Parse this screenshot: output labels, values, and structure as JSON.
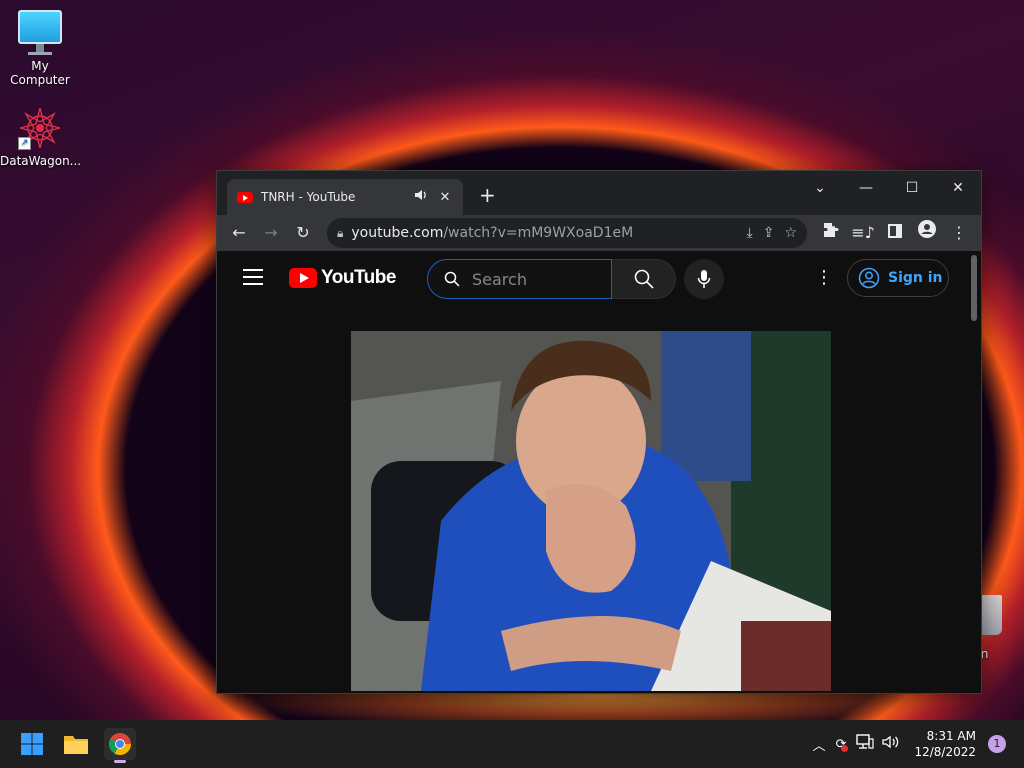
{
  "desktop": {
    "icons": [
      {
        "label": "My Computer"
      },
      {
        "label": "DataWagon..."
      },
      {
        "label": "e Bin"
      }
    ]
  },
  "browser": {
    "tab": {
      "title": "TNRH - YouTube",
      "audio_icon": "speaker-icon",
      "close": "✕"
    },
    "new_tab": "+",
    "window_controls": {
      "dropdown": "⌄",
      "minimize": "—",
      "maximize": "☐",
      "close": "✕"
    },
    "omnibox": {
      "host": "youtube.com",
      "path": "/watch?v=mM9WXoaD1eM"
    }
  },
  "youtube": {
    "logo_text": "YouTube",
    "search_placeholder": "Search",
    "signin_label": "Sign in"
  },
  "taskbar": {
    "time": "8:31 AM",
    "date": "12/8/2022",
    "notification_count": "1"
  },
  "colors": {
    "youtube_red": "#ff0000",
    "signin_blue": "#3ea6ff",
    "search_focus": "#1c62b9"
  }
}
